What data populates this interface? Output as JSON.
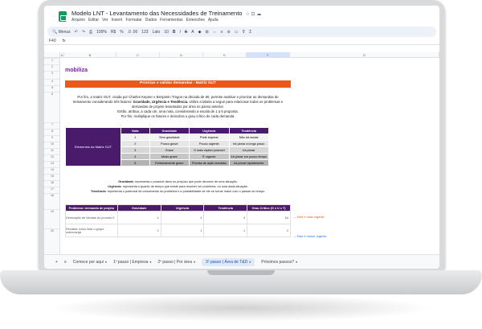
{
  "window": {
    "title": "Modelo LNT - Levantamento das Necessidades de Treinamento",
    "title_icons": "☆ ⊡ ☁",
    "menu": [
      "Arquivo",
      "Editar",
      "Ver",
      "Inserir",
      "Formatar",
      "Dados",
      "Ferramentas",
      "Extensões",
      "Ajuda"
    ]
  },
  "toolbar": {
    "search": "Menus",
    "zoom": "100%",
    "currency": "R$",
    "percent": "%",
    "decimals": ".0 .00",
    "format": "123",
    "font": "Lato",
    "font_size": "10"
  },
  "formula": {
    "cell": "F40",
    "fx": "fx"
  },
  "columns": [
    "A",
    "B",
    "C",
    "D",
    "E",
    "F",
    "G"
  ],
  "rows": [
    "1",
    "2",
    "3",
    "4",
    "5",
    "6",
    "7",
    "8",
    "9",
    "10",
    "11",
    "12",
    "13",
    "14",
    "15",
    "16",
    "17",
    "18",
    "19",
    "20"
  ],
  "sheet": {
    "logo": "mobiliza",
    "banner": "Priorizar e validar demandas - Matriz GUT",
    "paragraph_1": "Por fim, a matriz GUT, criada por Charles Kepner e Benjamin Tregoe na década de 80, permite analisar e priorizar as demandas de treinamento considerando três fatores:",
    "paragraph_bold": "Gravidade, Urgência e Tendência.",
    "paragraph_2": "Utilize a tabela a seguir para relacionar todos os problemas e demandas de projeto levantados por área no passo anterior.",
    "paragraph_3": "Então, atribua, a cada um, uma nota, considerando a escala de 1 a 5 proposta.",
    "paragraph_4": "Por fim, multiplique os fatores e descubra o grau crítico de cada demanda.",
    "gut": {
      "side_label": "Elementos da Matriz GUT",
      "headers": [
        "Nota",
        "Gravidade",
        "Urgência",
        "Tendência"
      ],
      "rows": [
        [
          "1",
          "Sem gravidade",
          "Pode esperar",
          "Não irá mudar"
        ],
        [
          "2",
          "Pouco grave",
          "Pouco urgente",
          "Irá piorar a longo prazo"
        ],
        [
          "3",
          "Grave",
          "O mais rápido possível",
          "Irá piorar"
        ],
        [
          "4",
          "Muito grave",
          "É urgente",
          "Irá piorar em pouco tempo"
        ],
        [
          "5",
          "Extremamente grave",
          "Precisa de ação imediata",
          "Irá piorar rapidamente"
        ]
      ]
    },
    "definitions": [
      {
        "term": "Gravidade:",
        "text": "representa o possível dano ou prejuízo que pode decorrer de uma situação."
      },
      {
        "term": "Urgência:",
        "text": "representa o quanto de tempo que existe para resolver um problema, ou uma dada situação."
      },
      {
        "term": "Tendência:",
        "text": "representa o potencial de crescimento do problema e a probabilidade de ele se tornar maior com o passar do tempo."
      }
    ],
    "main": {
      "headers": [
        "Problema / demanda de projeto",
        "Gravidade",
        "Urgência",
        "Tendência",
        "Grau Crítico (G x U x T)"
      ],
      "rows": [
        {
          "problem": "Diminuição de Vendas do produto X",
          "g": "4",
          "u": "4",
          "t": "4",
          "score": "64",
          "note": "← Este é mais urgente",
          "note_color": "#e8591a"
        },
        {
          "problem": "Revisitar como lidar o grupo sobrecarga",
          "g": "2",
          "u": "1",
          "t": "1",
          "score": "2",
          "note": "← Este é menor urgente",
          "note_color": "#1a73e8"
        }
      ]
    }
  },
  "tabs": {
    "add": "+",
    "list": "≡",
    "items": [
      "Comece por aqui",
      "1º passo | Empresa",
      "2º passo | Por área",
      "3º passo | Área de T&D",
      "Próximos passos?"
    ],
    "active": 3,
    "arrow": "▾"
  },
  "colors": {
    "accent_orange": "#e8591a",
    "brand_purple": "#4a1a6b",
    "sheets_green": "#0f9d58"
  }
}
